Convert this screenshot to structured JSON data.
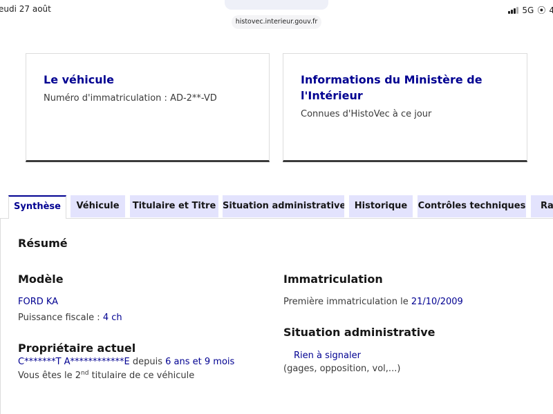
{
  "status_bar": {
    "date": "eudi 27 août",
    "network": "5G"
  },
  "address_bar": {
    "url": "histovec.interieur.gouv.fr"
  },
  "cards": {
    "vehicle": {
      "title": "Le véhicule",
      "text": "Numéro d'immatriculation : AD-2**-VD"
    },
    "ministry": {
      "title_line1": "Informations du Ministère de",
      "title_line2": "l'Intérieur",
      "text": "Connues d'HistoVec à ce jour"
    }
  },
  "tabs": [
    "Synthèse",
    "Véhicule",
    "Titulaire et Titre",
    "Situation administrative",
    "Historique",
    "Contrôles techniques",
    "Rap"
  ],
  "summary": {
    "title": "Résumé",
    "model": {
      "heading": "Modèle",
      "name": "FORD KA",
      "power_label": "Puissance fiscale : ",
      "power_value": "4 ch"
    },
    "owner": {
      "heading": "Propriétaire actuel",
      "name": "C*******T A************E",
      "since_label": " depuis ",
      "since_value": "6 ans et 9 mois",
      "rank_prefix": "Vous êtes le ",
      "rank_number": "2",
      "rank_suffix": "nd",
      "rank_text": " titulaire de ce véhicule"
    },
    "registration": {
      "heading": "Immatriculation",
      "first_label": "Première immatriculation le ",
      "first_date": "21/10/2009"
    },
    "admin": {
      "heading": "Situation administrative",
      "status": "Rien à signaler",
      "details": "(gages, opposition, vol,...)"
    }
  }
}
